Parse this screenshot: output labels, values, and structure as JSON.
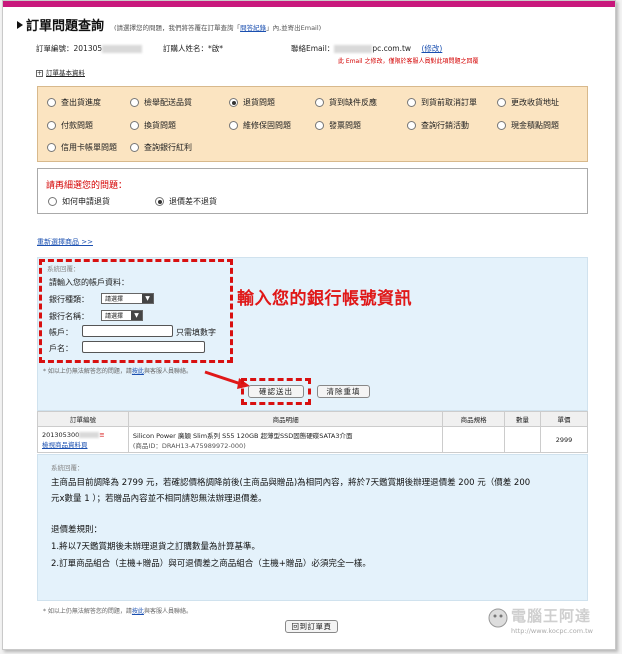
{
  "header": {
    "title": "訂單問題查詢",
    "subtitle_pre": "(請選擇您的問題，我們將答覆在訂單查詢「",
    "subtitle_link": "問答紀錄",
    "subtitle_post": "」內,並寄出Email)"
  },
  "order": {
    "order_no_label": "訂單編號：",
    "order_no_value": "201305",
    "buyer_label": "訂購人姓名：",
    "buyer_value": "*啟*",
    "email_label": "聯絡Email：",
    "email_value": "pc.com.tw",
    "email_edit": "(修改)",
    "email_note": "此 Email 之修改，僅限於客服人員對此項問題之回覆"
  },
  "basic_info_label": "訂單基本資料",
  "options": [
    {
      "label": "查出貨進度",
      "selected": false
    },
    {
      "label": "檢舉配送品質",
      "selected": false
    },
    {
      "label": "退貨問題",
      "selected": true
    },
    {
      "label": "貨到缺件反應",
      "selected": false
    },
    {
      "label": "到貨前取消訂單",
      "selected": false
    },
    {
      "label": "更改收貨地址",
      "selected": false
    },
    {
      "label": "付款問題",
      "selected": false
    },
    {
      "label": "換貨問題",
      "selected": false
    },
    {
      "label": "維修保固問題",
      "selected": false
    },
    {
      "label": "發票問題",
      "selected": false
    },
    {
      "label": "查詢行銷活動",
      "selected": false
    },
    {
      "label": "現金積點問題",
      "selected": false
    },
    {
      "label": "信用卡帳單問題",
      "selected": false
    },
    {
      "label": "查詢銀行紅利",
      "selected": false
    }
  ],
  "sub_question": {
    "title": "請再細選您的問題：",
    "options": [
      {
        "label": "如何申請退貨",
        "selected": false
      },
      {
        "label": "退價差不退貨",
        "selected": true
      }
    ]
  },
  "reselect_link": "重新選擇商品 >>",
  "form": {
    "system_reply": "系統回覆：",
    "prompt": "請輸入您的帳戶資料：",
    "bank_type_label": "銀行種類：",
    "bank_type_value": "請選擇",
    "bank_name_label": "銀行名稱：",
    "bank_name_value": "請選擇",
    "account_label": "帳戶：",
    "account_hint": "只需填數字",
    "name_label": "戶名：",
    "footnote_pre": "* 如以上仍無法解答您的問題，請",
    "footnote_link": "按此",
    "footnote_post": "與客服人員聯絡。",
    "confirm_button": "確認送出",
    "clear_button": "清除重填"
  },
  "callout": "輸入您的銀行帳號資訊",
  "table": {
    "headers": [
      "訂單編號",
      "商品明細",
      "商品規格",
      "數量",
      "單價"
    ],
    "row": {
      "order_no": "201305300",
      "order_link": "檢視商品資料頁",
      "item_name": "Silicon Power 廣穎 Slim系列 S55 120GB 超薄型SSD固態硬碟SATA3介面",
      "item_id": "(商品ID：DRAH13-A75989972-000)",
      "spec": "",
      "qty": "",
      "price": "2999"
    }
  },
  "info": {
    "system_reply": "系統回覆：",
    "line1": "主商品目前調降為 2799 元，若確認價格調降前後(主商品與贈品)為相同內容，將於7天鑑賞期後辦理退價差 200 元（價差 200",
    "line2": "元x數量 1 ）；若贈品內容並不相同請恕無法辦理退價差。",
    "rules_title": "退價差規則：",
    "rule1": "1.將以7天鑑賞期後未辦理退貨之訂購數量為計算基準。",
    "rule2": "2.訂單商品組合（主機+贈品）與可退價差之商品組合（主機+贈品）必須完全一樣。",
    "footnote_pre": "* 如以上仍無法解答您的問題，請",
    "footnote_link": "按此",
    "footnote_post": "與客服人員聯絡。"
  },
  "back_button": "回到訂單頁",
  "watermark": {
    "brand": "電腦王阿達",
    "url": "http://www.kocpc.com.tw"
  },
  "colors": {
    "accent": "#c8187c",
    "panel_orange": "#fbe4c1",
    "panel_blue": "#e4f2fb",
    "highlight_red": "#e01818"
  }
}
